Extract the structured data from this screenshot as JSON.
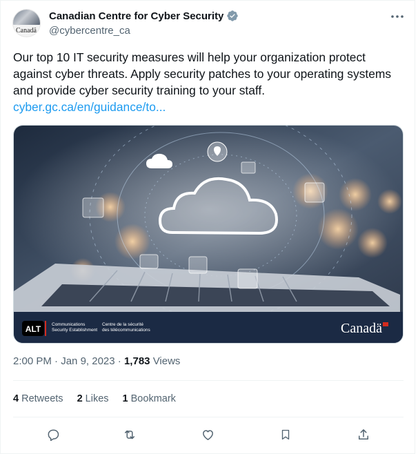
{
  "author": {
    "name": "Canadian Centre for Cyber Security",
    "handle": "@cybercentre_ca",
    "avatar_wordmark": "Canadä"
  },
  "tweet": {
    "text": "Our top 10 IT security measures will help your organization protect against cyber threats. Apply security patches to your operating systems and provide cyber security training to your staff.",
    "link": "cyber.gc.ca/en/guidance/to..."
  },
  "media": {
    "alt_badge": "ALT",
    "footer_en_line1": "Communications",
    "footer_en_line2": "Security Establishment",
    "footer_fr_line1": "Centre de la sécurité",
    "footer_fr_line2": "des télécommunications",
    "wordmark": "Canadä",
    "colors": {
      "footer_bg": "#1b2a44",
      "flag_red": "#d52b1e"
    }
  },
  "meta": {
    "time": "2:00 PM",
    "separator": "·",
    "date": "Jan 9, 2023",
    "views_count": "1,783",
    "views_label": "Views"
  },
  "stats": {
    "retweets_count": "4",
    "retweets_label": "Retweets",
    "likes_count": "2",
    "likes_label": "Likes",
    "bookmarks_count": "1",
    "bookmarks_label": "Bookmark"
  },
  "icons": [
    "verified-badge-icon",
    "more-icon",
    "reply-icon",
    "retweet-icon",
    "like-icon",
    "bookmark-icon",
    "share-icon"
  ],
  "colors": {
    "accent": "#1d9bf0",
    "text": "#0f1419",
    "secondary": "#536471"
  }
}
